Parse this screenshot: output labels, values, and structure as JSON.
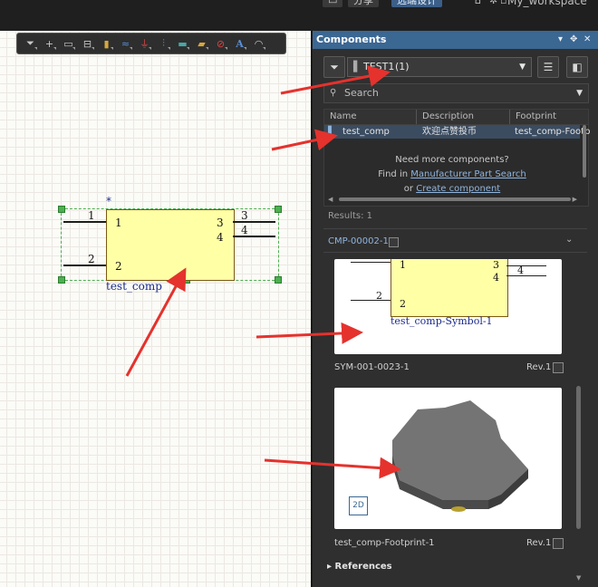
{
  "topbar": {
    "share_label": "分享",
    "active_label": "远端设计",
    "workspace": "My_workspace"
  },
  "schematic": {
    "toolbar_icons": [
      "filter-icon",
      "plus-icon",
      "select-rect-icon",
      "align-icon",
      "component-icon",
      "wire-icon",
      "power-icon",
      "bus-icon",
      "net-label-icon",
      "port-icon",
      "no-erc-icon",
      "text-icon",
      "arc-icon"
    ],
    "modified_marker": "*",
    "pins": {
      "p1_num": "1",
      "p1_label": "1",
      "p2_num": "2",
      "p2_label": "2",
      "p3_num": "3",
      "p3_label": "3",
      "p4_num": "4",
      "p4_label": "4"
    },
    "component_name": "test_comp"
  },
  "panel": {
    "title": "Components",
    "library": "TEST1",
    "library_count": "(1)",
    "search_placeholder": "Search",
    "columns": [
      "Name",
      "Description",
      "Footprint"
    ],
    "rows": [
      {
        "name": "test_comp",
        "description": "欢迎点赞投币",
        "footprint": "test_comp-Footp"
      }
    ],
    "more_title": "Need more components?",
    "find_in": "Find in",
    "mps_link": "Manufacturer Part Search",
    "or": "or",
    "create_link": "Create component",
    "results": "Results: 1",
    "cmp_id": "CMP-00002-1",
    "symbol": {
      "pin1": "1",
      "pin2": "2",
      "pin3": "3",
      "pin4": "4",
      "name": "test_comp-Symbol-1",
      "caption": "SYM-001-0023-1",
      "rev": "Rev.1"
    },
    "footprint": {
      "view_mode": "2D",
      "caption": "test_comp-Footprint-1",
      "rev": "Rev.1"
    },
    "references_label": "References"
  },
  "colors": {
    "panel_header": "#3b6793",
    "link": "#8fb4de",
    "component_fill": "#ffffa6",
    "component_name": "#1b2a8a",
    "selection": "#4caf50",
    "arrow": "#e5322d"
  }
}
